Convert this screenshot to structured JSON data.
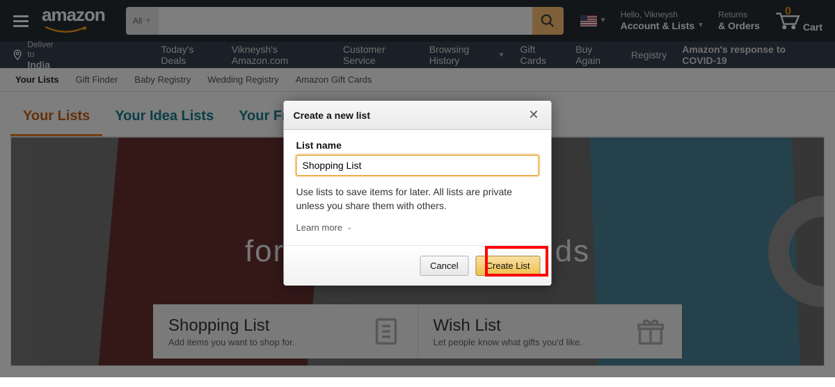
{
  "nav": {
    "logo": "amazon",
    "search_category": "All",
    "search_value": "",
    "flag": "en-US",
    "account_small": "Hello, Vikneysh",
    "account_bold": "Account & Lists",
    "returns_small": "Returns",
    "returns_bold": "& Orders",
    "cart_count": "0",
    "cart_label": "Cart"
  },
  "subnav": {
    "deliver_small": "Deliver to",
    "deliver_bold": "India",
    "links": [
      "Today's Deals",
      "Vikneysh's Amazon.com",
      "Customer Service",
      "Browsing History",
      "Gift Cards",
      "Buy Again",
      "Registry"
    ],
    "covid": "Amazon's response to COVID-19"
  },
  "sub2": {
    "links": [
      "Your Lists",
      "Gift Finder",
      "Baby Registry",
      "Wedding Registry",
      "Amazon Gift Cards"
    ],
    "active_index": 0
  },
  "tabs": {
    "items": [
      "Your Lists",
      "Your Idea Lists",
      "Your Friends"
    ],
    "active_index": 0
  },
  "hero": {
    "headline_left": "for",
    "headline_right": "ds",
    "cards": [
      {
        "title": "Shopping List",
        "desc": "Add items you want to shop for."
      },
      {
        "title": "Wish List",
        "desc": "Let people know what gifts you'd like."
      }
    ]
  },
  "modal": {
    "title": "Create a new list",
    "field_label": "List name",
    "input_value": "Shopping List",
    "help_text": "Use lists to save items for later. All lists are private unless you share them with others.",
    "learn_more": "Learn more",
    "cancel": "Cancel",
    "submit": "Create List"
  }
}
